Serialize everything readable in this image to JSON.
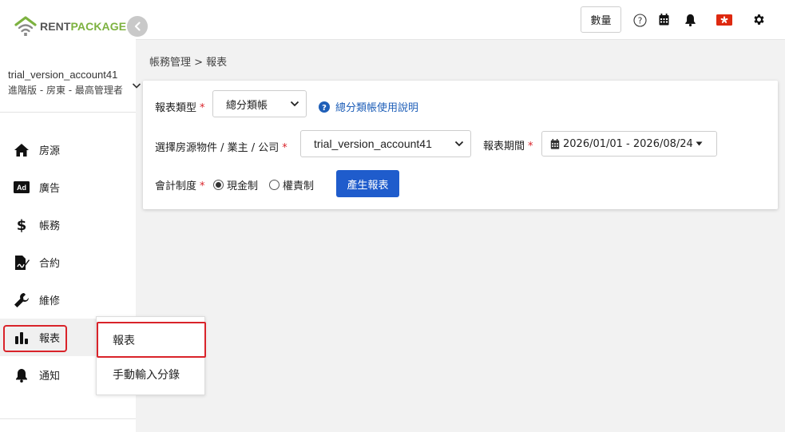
{
  "logo": {
    "rent": "RENT",
    "package": "PACKAGE"
  },
  "account": {
    "name": "trial_version_account41",
    "role": "進階版 - 房東 - 最高管理者"
  },
  "sidebar": {
    "items": [
      {
        "label": "房源",
        "icon": "home-icon"
      },
      {
        "label": "廣告",
        "icon": "ad-icon"
      },
      {
        "label": "帳務",
        "icon": "dollar-icon"
      },
      {
        "label": "合約",
        "icon": "contract-icon"
      },
      {
        "label": "維修",
        "icon": "wrench-icon"
      },
      {
        "label": "報表",
        "icon": "bar-chart-icon"
      },
      {
        "label": "通知",
        "icon": "bell-icon"
      }
    ],
    "active_index": 5
  },
  "submenu": {
    "items": [
      {
        "label": "報表"
      },
      {
        "label": "手動輸入分錄"
      }
    ]
  },
  "topbar": {
    "qty_label": "數量"
  },
  "breadcrumb": "帳務管理 > 報表",
  "form": {
    "report_type": {
      "label": "報表類型",
      "value": "總分類帳"
    },
    "help_link": "總分類帳使用說明",
    "property": {
      "label": "選擇房源物件 / 業主 / 公司",
      "value": "trial_version_account41"
    },
    "period": {
      "label": "報表期間",
      "value": "2026/01/01 - 2026/08/24"
    },
    "accounting": {
      "label": "會計制度",
      "options": [
        {
          "label": "現金制",
          "selected": true
        },
        {
          "label": "權責制",
          "selected": false
        }
      ]
    },
    "generate_label": "產生報表"
  },
  "colors": {
    "accent": "#1f5ccc",
    "brand_green": "#7db240",
    "highlight_red": "#d9232a",
    "link": "#1f5fb8"
  }
}
